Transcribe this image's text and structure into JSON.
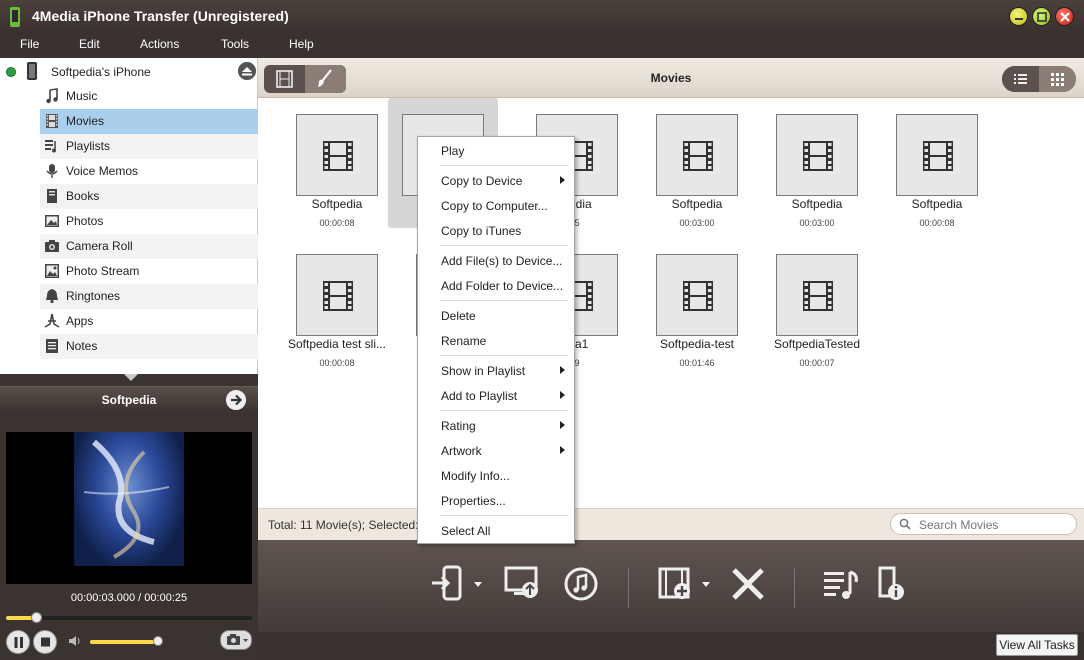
{
  "window": {
    "title": "4Media iPhone Transfer (Unregistered)"
  },
  "menu": [
    "File",
    "Edit",
    "Actions",
    "Tools",
    "Help"
  ],
  "device": {
    "name": "Softpedia's iPhone"
  },
  "sidebar": {
    "items": [
      {
        "label": "Music",
        "icon": "music-note-icon"
      },
      {
        "label": "Movies",
        "icon": "film-icon"
      },
      {
        "label": "Playlists",
        "icon": "playlist-icon"
      },
      {
        "label": "Voice Memos",
        "icon": "microphone-icon"
      },
      {
        "label": "Books",
        "icon": "book-icon"
      },
      {
        "label": "Photos",
        "icon": "photo-icon"
      },
      {
        "label": "Camera Roll",
        "icon": "camera-icon"
      },
      {
        "label": "Photo Stream",
        "icon": "photo-stream-icon"
      },
      {
        "label": "Ringtones",
        "icon": "bell-icon"
      },
      {
        "label": "Apps",
        "icon": "apps-icon"
      },
      {
        "label": "Notes",
        "icon": "notes-icon"
      }
    ],
    "selected": "Movies"
  },
  "preview": {
    "title": "Softpedia",
    "timecode": "00:00:03.000 / 00:00:25",
    "progress": 0.12,
    "volume": 0.95
  },
  "main": {
    "title": "Movies",
    "tiles": [
      {
        "name": "Softpedia",
        "duration": "00:00:08"
      },
      {
        "name": "",
        "duration": ""
      },
      {
        "name": "pedia",
        "duration": "5"
      },
      {
        "name": "Softpedia",
        "duration": "00:03:00"
      },
      {
        "name": "Softpedia",
        "duration": "00:03:00"
      },
      {
        "name": "Softpedia",
        "duration": "00:00:08"
      },
      {
        "name": "Softpedia test sli...",
        "duration": "00:00:08"
      },
      {
        "name": "S",
        "duration": ""
      },
      {
        "name": "dia1",
        "duration": "9"
      },
      {
        "name": "Softpedia-test",
        "duration": "00:01:46"
      },
      {
        "name": "SoftpediaTested",
        "duration": "00:00:07"
      }
    ]
  },
  "status": {
    "text": "Total: 11 Movie(s); Selected:",
    "search_placeholder": "Search Movies"
  },
  "context_menu": {
    "items": [
      {
        "label": "Play",
        "submenu": false
      },
      {
        "label": "Copy to Device",
        "submenu": true
      },
      {
        "label": "Copy to Computer...",
        "submenu": false
      },
      {
        "label": "Copy to iTunes",
        "submenu": false
      },
      {
        "label": "Add File(s) to Device...",
        "submenu": false
      },
      {
        "label": "Add Folder to Device...",
        "submenu": false
      },
      {
        "label": "Delete",
        "submenu": false
      },
      {
        "label": "Rename",
        "submenu": false
      },
      {
        "label": "Show in Playlist",
        "submenu": true
      },
      {
        "label": "Add to Playlist",
        "submenu": true
      },
      {
        "label": "Rating",
        "submenu": true
      },
      {
        "label": "Artwork",
        "submenu": true
      },
      {
        "label": "Modify Info...",
        "submenu": false
      },
      {
        "label": "Properties...",
        "submenu": false
      },
      {
        "label": "Select All",
        "submenu": false
      }
    ]
  },
  "footer": {
    "view_all_tasks": "View All Tasks"
  },
  "colors": {
    "accent_selected": "#a9cfec",
    "progress_fill": "#ffd84a",
    "chrome_dark": "#3a3230"
  }
}
